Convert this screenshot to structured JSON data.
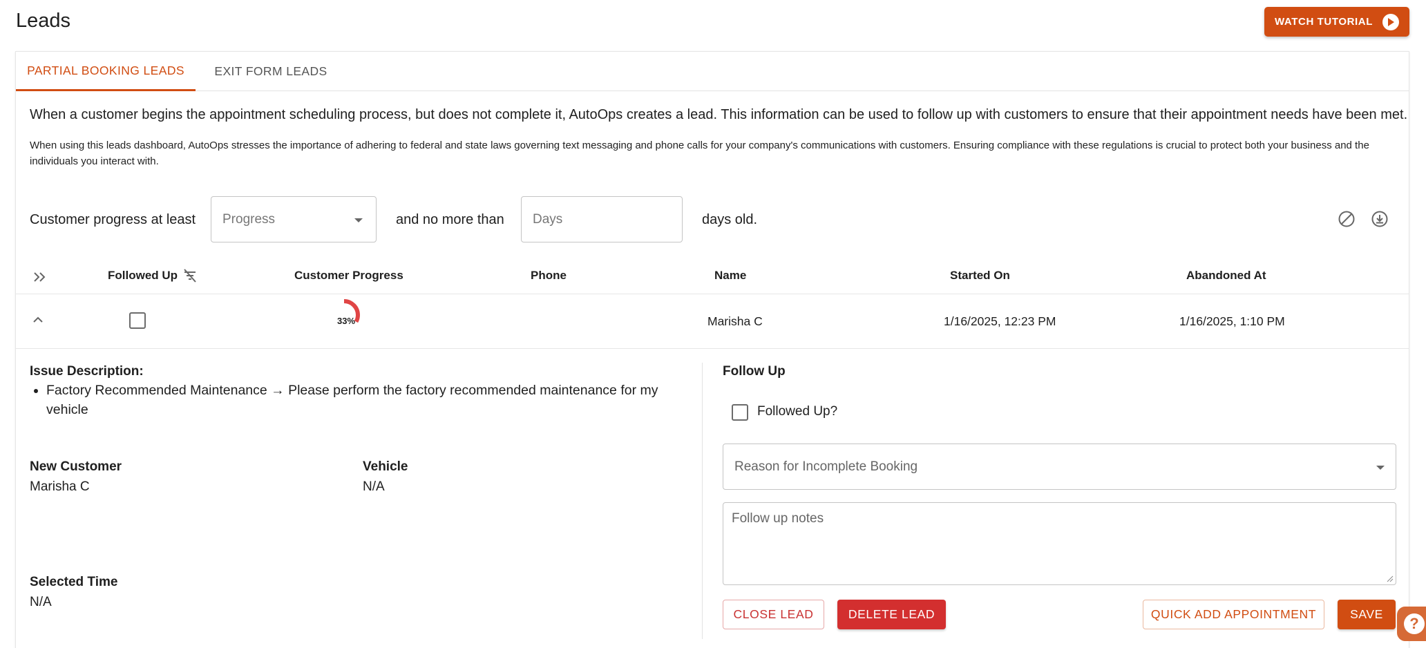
{
  "page": {
    "title": "Leads"
  },
  "header": {
    "tutorial_label": "WATCH TUTORIAL"
  },
  "tabs": [
    {
      "label": "PARTIAL BOOKING LEADS",
      "active": true
    },
    {
      "label": "EXIT FORM LEADS",
      "active": false
    }
  ],
  "description": {
    "main": "When a customer begins the appointment scheduling process, but does not complete it, AutoOps creates a lead. This information can be used to follow up with customers to ensure that their appointment needs have been met.",
    "compliance": "When using this leads dashboard, AutoOps stresses the importance of adhering to federal and state laws governing text messaging and phone calls for your company's communications with customers. Ensuring compliance with these regulations is crucial to protect both your business and the individuals you interact with."
  },
  "filters": {
    "prefix": "Customer progress at least",
    "progress_placeholder": "Progress",
    "middle": "and no more than",
    "days_placeholder": "Days",
    "suffix": "days old."
  },
  "table": {
    "columns": [
      "Followed Up",
      "Customer Progress",
      "Phone",
      "Name",
      "Started On",
      "Abandoned At"
    ],
    "rows": [
      {
        "followed_up": false,
        "progress_label": "33%",
        "progress_value": 0.33,
        "phone": "",
        "name": "Marisha C",
        "started_on": "1/16/2025, 12:23 PM",
        "abandoned_at": "1/16/2025, 1:10 PM"
      }
    ]
  },
  "detail": {
    "issue_label": "Issue Description:",
    "issues": [
      "Factory Recommended Maintenance → Please perform the factory recommended maintenance for my vehicle"
    ],
    "new_customer_label": "New Customer",
    "new_customer_value": "Marisha C",
    "vehicle_label": "Vehicle",
    "vehicle_value": "N/A",
    "selected_time_label": "Selected Time",
    "selected_time_value": "N/A"
  },
  "follow_up": {
    "title": "Follow Up",
    "checkbox_label": "Followed Up?",
    "reason_placeholder": "Reason for Incomplete Booking",
    "notes_placeholder": "Follow up notes",
    "buttons": {
      "close": "CLOSE LEAD",
      "delete": "DELETE LEAD",
      "quick_add": "QUICK ADD APPOINTMENT",
      "save": "SAVE"
    }
  },
  "help": {
    "glyph": "?"
  },
  "colors": {
    "accent": "#d14d12",
    "danger": "#d32f2f",
    "progress": "#e04545"
  }
}
